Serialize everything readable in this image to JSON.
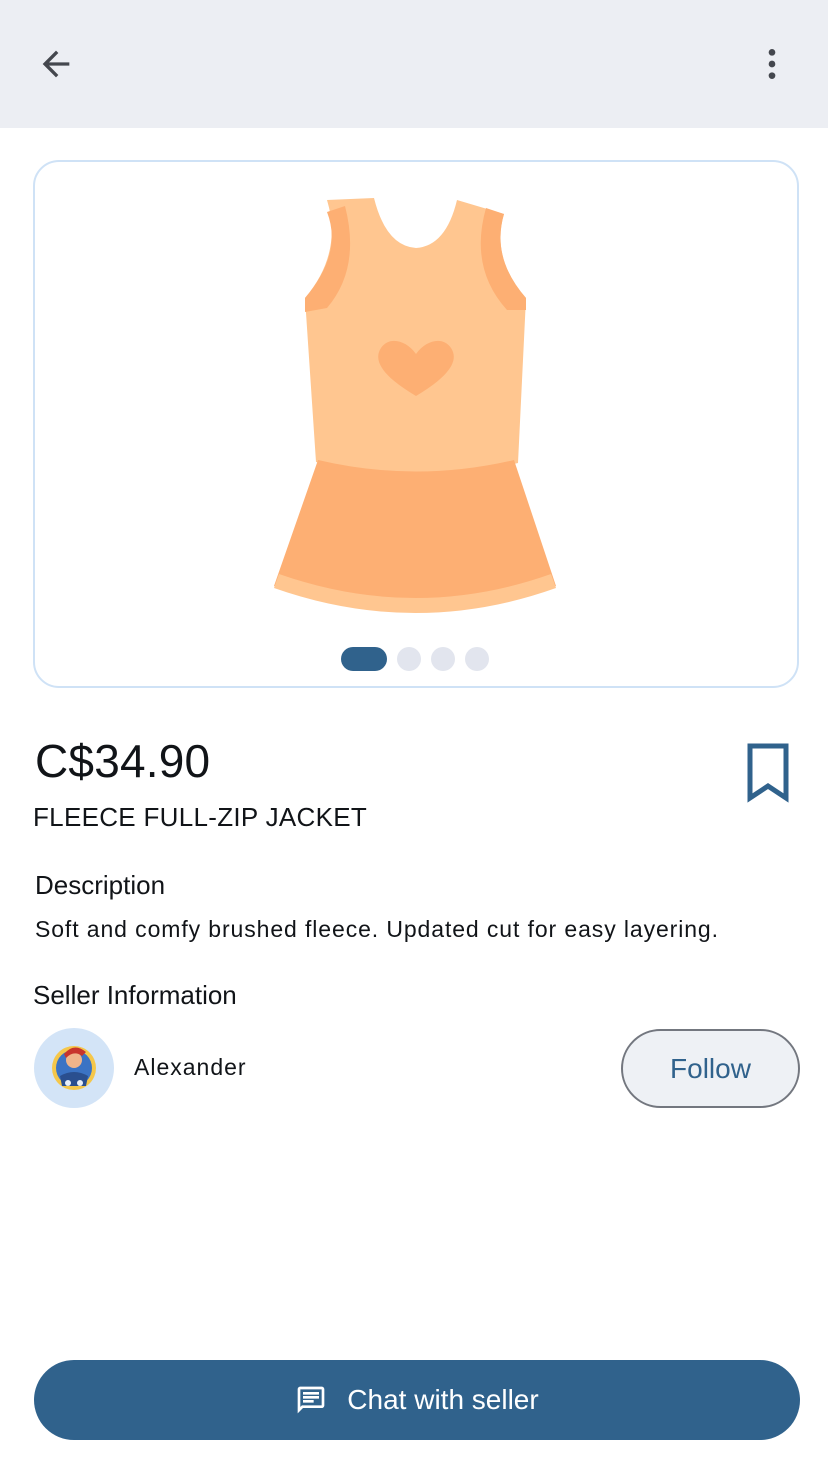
{
  "topbar": {
    "back_icon": "arrow-back-icon",
    "more_icon": "more-vert-icon"
  },
  "product": {
    "image_icon": "dress-illustration",
    "pager": {
      "count": 4,
      "active_index": 0
    },
    "price": "C$34.90",
    "title": "FLEECE FULL-ZIP JACKET",
    "bookmark_icon": "bookmark-outline-icon"
  },
  "description": {
    "heading": "Description",
    "text": "Soft and comfy brushed fleece. Updated cut for easy layering."
  },
  "seller": {
    "heading": "Seller Information",
    "name": "Alexander",
    "follow_label": "Follow"
  },
  "chat": {
    "label": "Chat with seller",
    "icon": "chat-icon"
  },
  "colors": {
    "primary": "#30628c",
    "topbar_bg": "#eceef3",
    "card_border": "#cfe2f6",
    "avatar_bg": "#d3e4f7",
    "dress_top": "#ffc690",
    "dress_skirt": "#fdaf73"
  }
}
